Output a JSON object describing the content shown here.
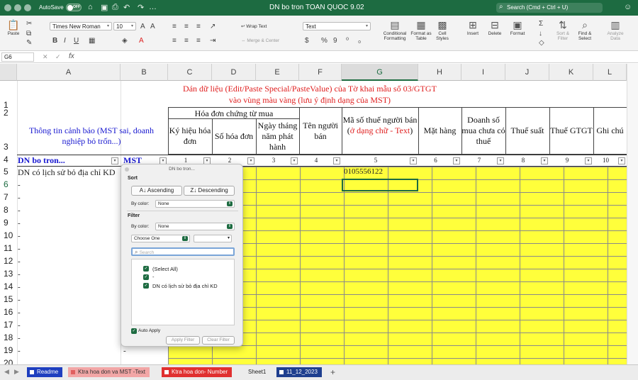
{
  "titlebar": {
    "autosave_label": "AutoSave",
    "toggle_state": "OFF",
    "doc_title": "DN bo tron TOAN QUOC 9.02",
    "search_placeholder": "Search (Cmd + Ctrl + U)"
  },
  "ribbon": {
    "paste": "Paste",
    "font_name": "Times New Roman",
    "font_size": "10",
    "bold": "B",
    "italic": "I",
    "underline": "U",
    "wrap_text": "Wrap Text",
    "merge_center": "Merge & Center",
    "number_format": "Text",
    "percent": "%",
    "comma": "9",
    "conditional_formatting": "Conditional Formatting",
    "format_as_table": "Format as Table",
    "cell_styles": "Cell Styles",
    "insert": "Insert",
    "delete": "Delete",
    "format": "Format",
    "sort_filter": "Sort & Filter",
    "find_select": "Find & Select",
    "analyze_data": "Analyze Data"
  },
  "formula_bar": {
    "name_box": "G6",
    "fx": "fx",
    "value": ""
  },
  "columns": [
    "A",
    "B",
    "C",
    "D",
    "E",
    "F",
    "G",
    "H",
    "I",
    "J",
    "K",
    "L"
  ],
  "selected_column": "G",
  "rows": [
    "1",
    "2",
    "3",
    "4",
    "5",
    "6",
    "7",
    "8",
    "9",
    "10",
    "11",
    "12",
    "13",
    "14",
    "15",
    "16",
    "17",
    "18",
    "19",
    "20"
  ],
  "sheet": {
    "instruction_line1": "Dán dữ liệu (Edit/Paste Special/PasteValue) của Tờ khai mẫu số  03/GTGT",
    "instruction_line2": "vào vùng màu vàng (lưu ý định dạng của MST)",
    "invoice_group": "Hóa đơn chứng từ mua",
    "warning_info": "Thông tin cảnh báo (MST sai, doanh nghiệp bỏ trốn...)",
    "headers": {
      "c": "Ký hiệu hóa đơn",
      "d": "Số hóa đơn",
      "e": "Ngày tháng năm phát hành",
      "f": "Tên người bán",
      "g_main": "Mã số thuế người bán (",
      "g_red": "ở dạng chữ - Text",
      "g_end": ")",
      "h": "Mặt hàng",
      "i": "Doanh số mua chưa có thuế",
      "j": "Thuế suất",
      "k": "Thuế GTGT",
      "l": "Ghi chú"
    },
    "row4_a": "DN bo tron...",
    "row4_b": "MST",
    "col_numbers": [
      "1",
      "2",
      "3",
      "4",
      "5",
      "6",
      "7",
      "8",
      "9",
      "10"
    ],
    "row5_a": "DN có lịch sử bỏ địa chỉ KD",
    "row5_g": "0105556122",
    "dash": "-"
  },
  "filter_popup": {
    "title": "DN bo tron...",
    "sort_label": "Sort",
    "ascending": "Ascending",
    "descending": "Descending",
    "by_color": "By color:",
    "none": "None",
    "filter_label": "Filter",
    "choose_one": "Choose One",
    "search_placeholder": "Search",
    "items": [
      "(Select All)",
      "-",
      "DN có lịch sử bỏ địa chỉ KD"
    ],
    "auto_apply": "Auto Apply",
    "apply_filter": "Apply Filter",
    "clear_filter": "Clear Filter"
  },
  "tabs": [
    {
      "label": "Readme",
      "color": "#1f3fbf"
    },
    {
      "label": "Ktra hoa don va MST -Text",
      "color": "#f2a6a6"
    },
    {
      "label": "Ktra hoa don- Number",
      "color": "#e03030"
    },
    {
      "label": "Sheet1",
      "color": "#ececec"
    },
    {
      "label": "11_12_2023",
      "color": "#1f3f8f"
    }
  ],
  "add_sheet": "+"
}
